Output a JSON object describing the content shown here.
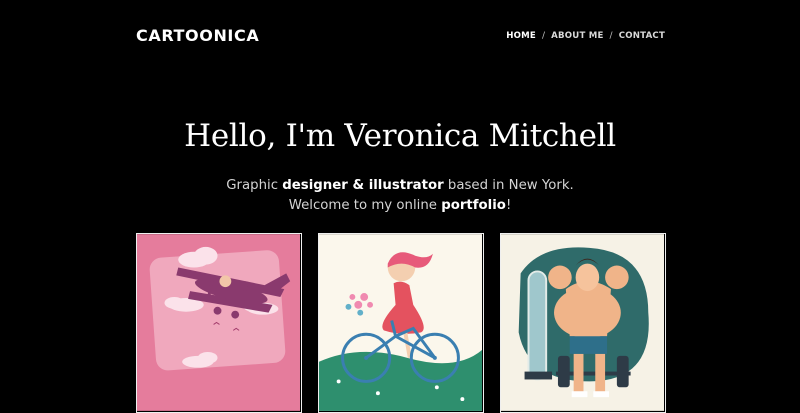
{
  "header": {
    "brand": "CARTOONICA",
    "nav": [
      {
        "label": "HOME",
        "active": true
      },
      {
        "label": "ABOUT ME",
        "active": false
      },
      {
        "label": "CONTACT",
        "active": false
      }
    ],
    "separator": "/"
  },
  "hero": {
    "title": "Hello, I'm Veronica Mitchell",
    "line1": {
      "pre": "Graphic ",
      "strong1": "designer & illustrator",
      "post": " based in New York."
    },
    "line2": {
      "pre": "Welcome to my online ",
      "strong": "portfolio",
      "post": "!"
    }
  },
  "portfolio": [
    {
      "icon": "airplane-illustration",
      "bg": "#e57c9c"
    },
    {
      "icon": "girl-on-bicycle-illustration",
      "bg": "#fbf7ec"
    },
    {
      "icon": "muscleman-mirror-illustration",
      "bg": "#f6f2e6"
    }
  ],
  "colors": {
    "background": "#000000",
    "text": "#ffffff",
    "muted": "#d4d4d4"
  }
}
